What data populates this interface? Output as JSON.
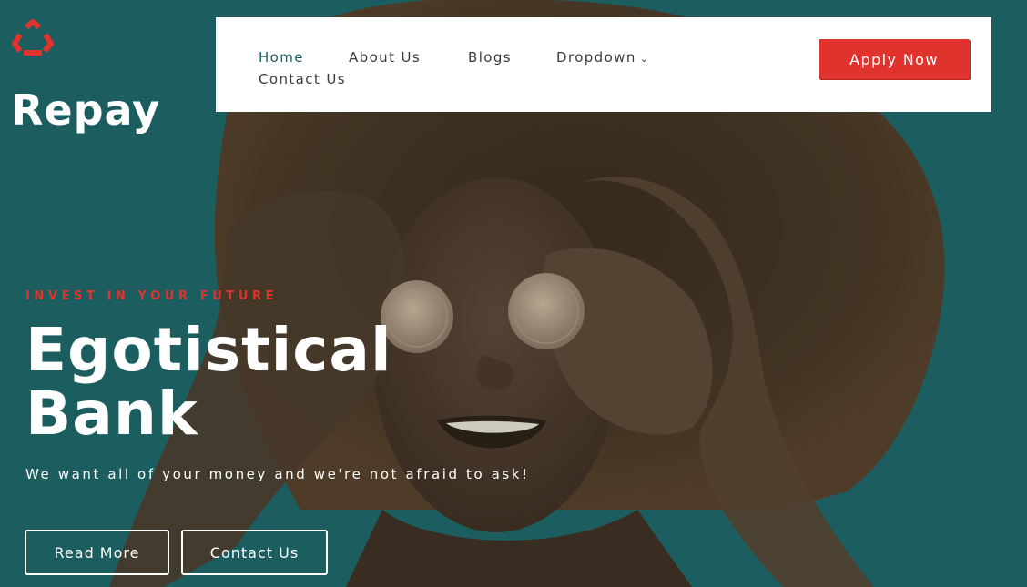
{
  "brand": {
    "name": "Repay",
    "logo_icon": "recycle-icon",
    "accent_color": "#e0332e",
    "teal_color": "#1f5f62"
  },
  "nav": {
    "items": [
      {
        "label": "Home",
        "active": true
      },
      {
        "label": "About Us"
      },
      {
        "label": "Blogs"
      },
      {
        "label": "Dropdown",
        "icon": "chevron-down-icon"
      },
      {
        "label": "Contact Us"
      }
    ],
    "cta": "Apply Now"
  },
  "hero": {
    "kicker": "INVEST IN YOUR FUTURE",
    "title_line1": "Egotistical",
    "title_line2": "Bank",
    "subtitle": "We want all of your money and we're not afraid to ask!",
    "primary_button": "Read More",
    "secondary_button": "Contact Us",
    "image": "woman-holding-coins-over-eyes"
  }
}
